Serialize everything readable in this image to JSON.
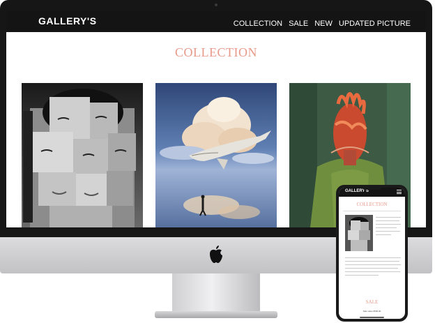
{
  "site": {
    "logo": "GALLERY'S",
    "nav": [
      "COLLECTION",
      "SALE",
      "NEW",
      "UPDATED PICTURE"
    ],
    "heading": "COLLECTION"
  },
  "artworks": [
    {
      "subject": "fragmented black and white portrait of a woman"
    },
    {
      "subject": "whale flying among clouds over reflective water with a lone walker"
    },
    {
      "subject": "painted figure with red abstract head on green background"
    }
  ],
  "mobile": {
    "logo": "GALLERY'S",
    "heading": "COLLECTION",
    "section_title": "SALE",
    "footer_text": "Sale value €500.00"
  },
  "colors": {
    "accent": "#e89a8a",
    "nav_bg": "#141414",
    "bezel": "#161616"
  }
}
